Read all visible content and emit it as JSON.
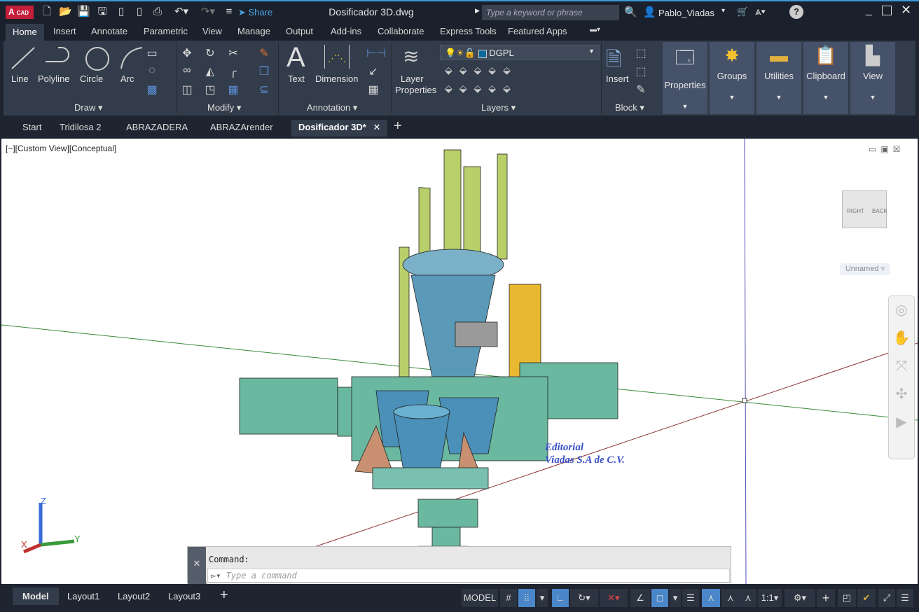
{
  "app": {
    "logo": "A",
    "logo_sub": "CAD",
    "title": "Dosificador 3D.dwg",
    "share": "Share",
    "search_placeholder": "Type a keyword or phrase",
    "user": "Pablo_Viadas"
  },
  "ribbon_tabs": [
    "Home",
    "Insert",
    "Annotate",
    "Parametric",
    "View",
    "Manage",
    "Output",
    "Add-ins",
    "Collaborate",
    "Express Tools",
    "Featured Apps"
  ],
  "draw": {
    "line": "Line",
    "polyline": "Polyline",
    "circle": "Circle",
    "arc": "Arc",
    "panel": "Draw ▾"
  },
  "modify": {
    "panel": "Modify ▾"
  },
  "annotation": {
    "text": "Text",
    "dimension": "Dimension",
    "panel": "Annotation ▾"
  },
  "layers": {
    "layer_properties_1": "Layer",
    "layer_properties_2": "Properties",
    "current_layer": "DGPL",
    "panel": "Layers ▾",
    "layer_color": "#0e6a9a"
  },
  "block": {
    "insert": "Insert",
    "panel": "Block ▾"
  },
  "big_panels": [
    "Properties",
    "Groups",
    "Utilities",
    "Clipboard",
    "View"
  ],
  "doc_tabs": [
    "Start",
    "Tridilosa 2",
    "ABRAZADERA",
    "ABRAZArender",
    "Dosificador 3D*"
  ],
  "viewport": {
    "label": "[−][Custom View][Conceptual]",
    "viewcube_right": "RIGHT",
    "viewcube_back": "BACK",
    "named_view": "Unnamed",
    "watermark_1": "Editorial",
    "watermark_2": "Viadas S.A de C.V.",
    "ucs_x": "X",
    "ucs_y": "Y",
    "ucs_z": "Z"
  },
  "command": {
    "history": "Command:",
    "placeholder": "Type a command"
  },
  "layout_tabs": [
    "Model",
    "Layout1",
    "Layout2",
    "Layout3"
  ],
  "status": {
    "model": "MODEL",
    "scale": "1:1"
  }
}
